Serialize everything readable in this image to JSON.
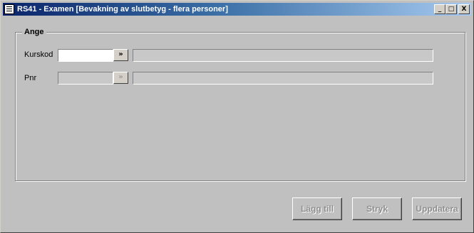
{
  "window": {
    "title": "RS41 - Examen [Bevakning av slutbetyg - flera personer]",
    "controls": {
      "minimize": "_",
      "maximize": "□",
      "close": "X"
    }
  },
  "group": {
    "legend": "Ange",
    "fields": [
      {
        "label": "Kurskod",
        "value": "",
        "lookup_glyph": "»",
        "enabled": true,
        "description": ""
      },
      {
        "label": "Pnr",
        "value": "",
        "lookup_glyph": "»",
        "enabled": false,
        "description": ""
      }
    ]
  },
  "actions": {
    "add_label": "Lägg till",
    "delete_label": "Stryk",
    "update_label": "Uppdatera"
  },
  "colors": {
    "window_bg": "#c0c0c0",
    "titlebar_start": "#0a246a",
    "titlebar_end": "#a6caf0",
    "disabled_text": "#8f8f8f"
  }
}
